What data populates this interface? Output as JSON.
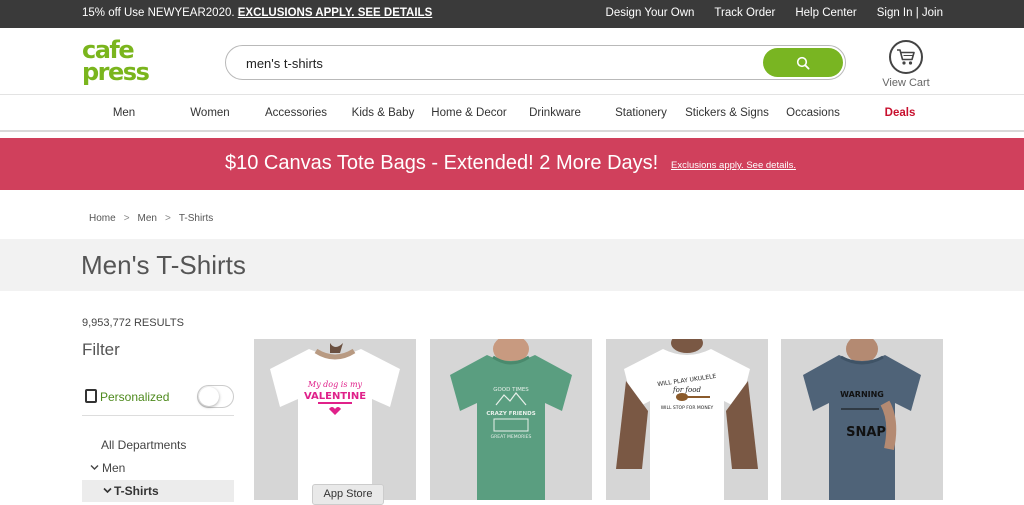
{
  "topbar": {
    "promo_text": "15% off Use NEWYEAR2020.",
    "promo_link": "EXCLUSIONS APPLY. SEE DETAILS",
    "links": [
      "Design Your Own",
      "Track Order",
      "Help Center",
      "Sign In | Join"
    ]
  },
  "header": {
    "logo_line1": "cafe",
    "logo_line2": "press",
    "search_value": "men's t-shirts",
    "search_icon": "search-icon",
    "cart_label": "View Cart",
    "cart_icon": "shopping-cart-icon"
  },
  "nav": {
    "items": [
      "Men",
      "Women",
      "Accessories",
      "Kids & Baby",
      "Home & Decor",
      "Drinkware",
      "Stationery",
      "Stickers & Signs",
      "Occasions",
      "Deals"
    ]
  },
  "banner": {
    "headline": "$10 Canvas Tote Bags - Extended! 2 More Days!",
    "details": "Exclusions apply. See details."
  },
  "breadcrumb": [
    "Home",
    "Men",
    "T-Shirts"
  ],
  "breadcrumb_sep": ">",
  "page_title": "Men's T-Shirts",
  "sidebar": {
    "results": "9,953,772 RESULTS",
    "filter_title": "Filter",
    "personalized_label": "Personalized",
    "all_departments": "All Departments",
    "men": "Men",
    "tshirts": "T-Shirts"
  },
  "products": [
    {
      "shirt_color": "#ffffff",
      "text_lines": [
        "My dog is my",
        "VALENTINE"
      ],
      "text_color": "#e0218a"
    },
    {
      "shirt_color": "#5a9e80",
      "text_lines": [
        "GOOD TIMES",
        "CRAZY FRIENDS",
        "GREAT MEMORIES"
      ],
      "text_color": "#e8f0ea"
    },
    {
      "shirt_color": "#ffffff",
      "text_lines": [
        "WILL PLAY UKULELE",
        "for food",
        "WILL STOP FOR MONEY"
      ],
      "text_color": "#222222"
    },
    {
      "shirt_color": "#4f6378",
      "text_lines": [
        "WARNING",
        "SNAP"
      ],
      "text_color": "#111111"
    }
  ],
  "app_store": "App Store",
  "colors": {
    "accent_green": "#79b522",
    "banner_pink": "#d0405c",
    "deals_red": "#c8102e",
    "topbar": "#3a3a3a"
  }
}
